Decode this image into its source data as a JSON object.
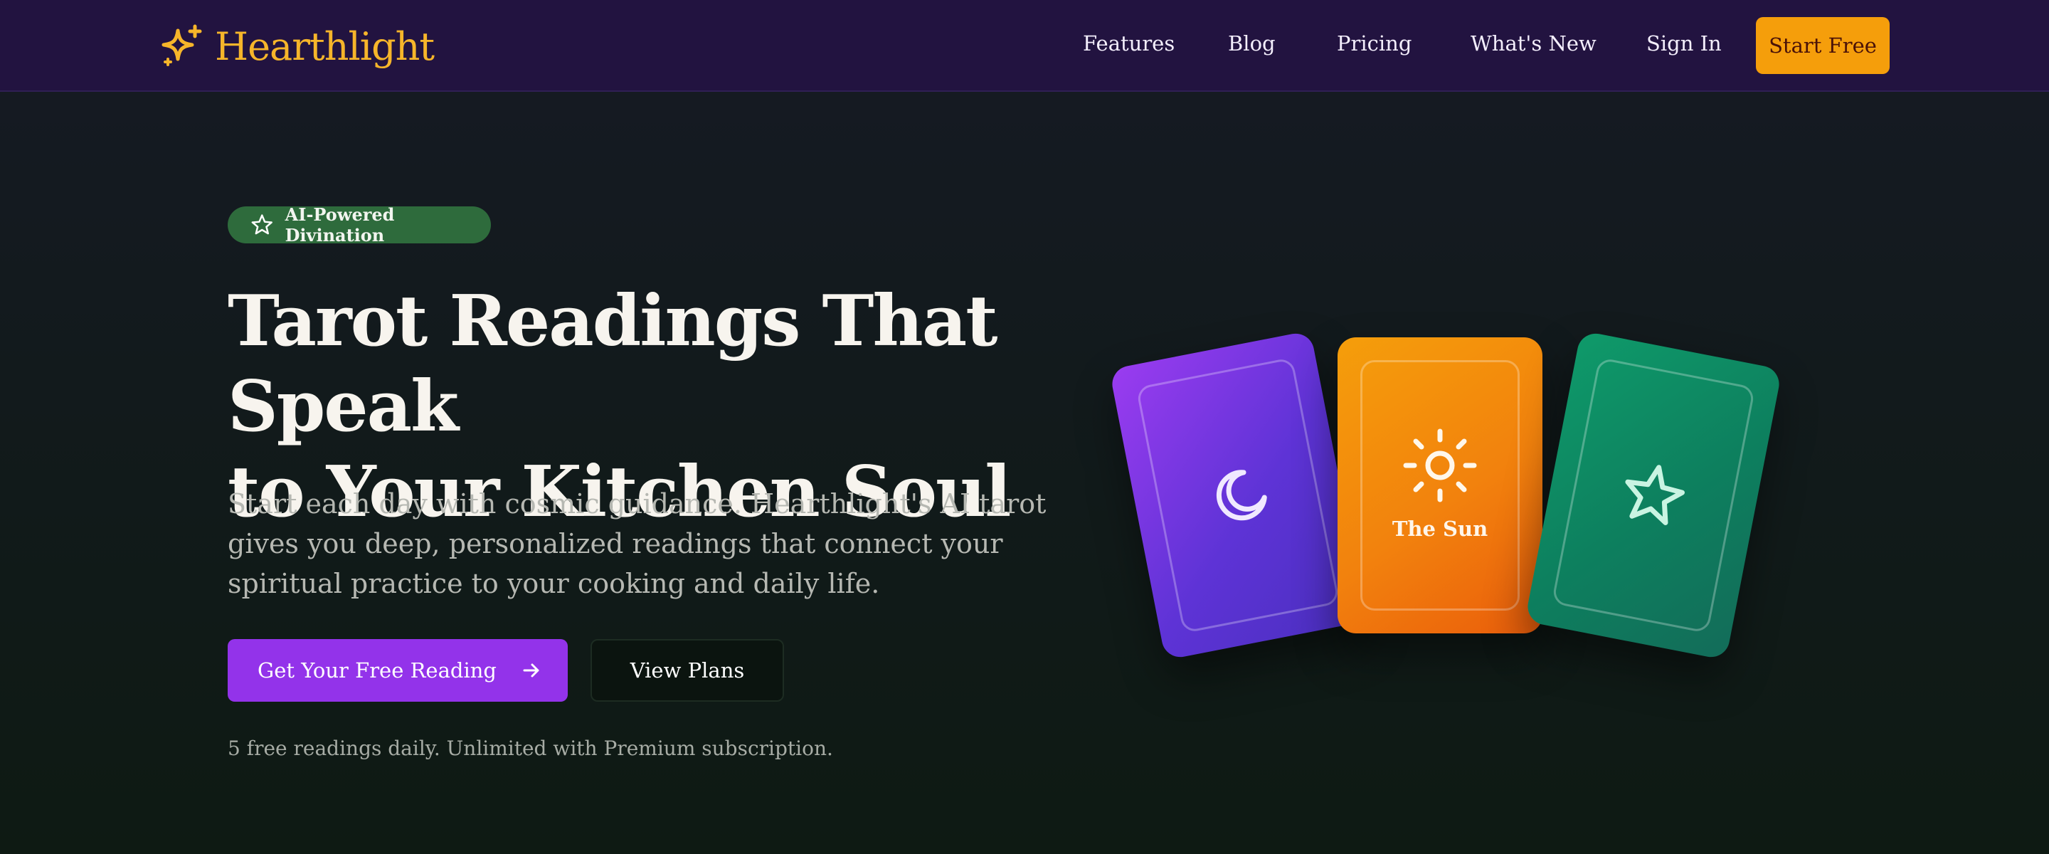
{
  "nav": {
    "brand": "Hearthlight",
    "links": [
      "Features",
      "Blog",
      "Pricing",
      "What's New",
      "Sign In"
    ],
    "cta": "Start Free"
  },
  "hero": {
    "badge": "AI-Powered Divination",
    "headline_line1": "Tarot Readings That Speak",
    "headline_line2": "to Your Kitchen Soul",
    "subtext": "Start each day with cosmic guidance. Hearthlight's AI tarot gives you deep, personalized readings that connect your spiritual practice to your cooking and daily life.",
    "primary_cta": "Get Your Free Reading",
    "secondary_cta": "View Plans",
    "note": "5 free readings daily. Unlimited with Premium subscription."
  },
  "cards": {
    "center_label": "The Sun"
  },
  "icons": {
    "logo": "sparkles-icon",
    "badge": "star-icon",
    "cta": "arrow-right-icon",
    "card1": "moon-icon",
    "card2": "sun-icon",
    "card3": "star-icon"
  },
  "colors": {
    "nav_bg": "#221340",
    "brand": "#f6b52a",
    "accent_orange": "#f59e0b",
    "accent_purple": "#9333ea",
    "badge_green": "#2e6b3c"
  }
}
